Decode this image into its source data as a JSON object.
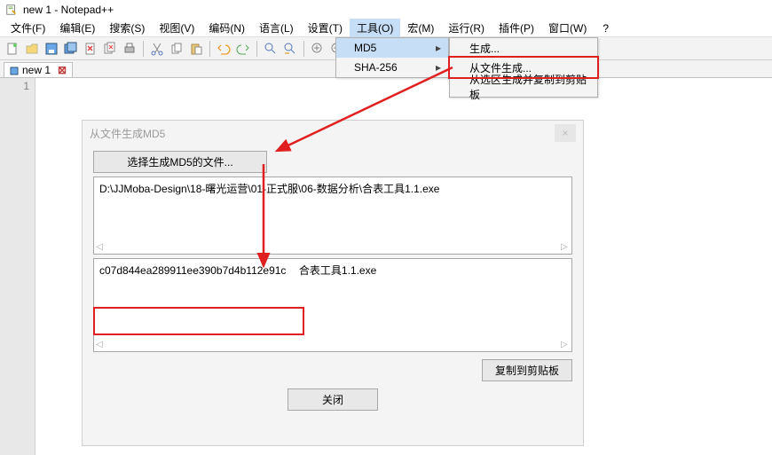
{
  "window": {
    "title": "new 1 - Notepad++"
  },
  "menus": [
    "文件(F)",
    "编辑(E)",
    "搜索(S)",
    "视图(V)",
    "编码(N)",
    "语言(L)",
    "设置(T)",
    "工具(O)",
    "宏(M)",
    "运行(R)",
    "插件(P)",
    "窗口(W)"
  ],
  "dropdown_tools": {
    "items": [
      "MD5",
      "SHA-256"
    ]
  },
  "dropdown_md5": {
    "items": [
      "生成...",
      "从文件生成...",
      "从选区生成并复制到剪贴板"
    ]
  },
  "tab": {
    "name": "new 1"
  },
  "gutter": {
    "line1": "1"
  },
  "dialog": {
    "title": "从文件生成MD5",
    "choose_btn": "选择生成MD5的文件...",
    "path_text": "D:\\JJMoba-Design\\18-曙光运营\\01-正式服\\06-数据分析\\合表工具1.1.exe",
    "md5_hash": "c07d844ea289911ee390b7d4b112e91c",
    "md5_file": "合表工具1.1.exe",
    "copy_btn": "复制到剪贴板",
    "close_btn": "关闭"
  }
}
